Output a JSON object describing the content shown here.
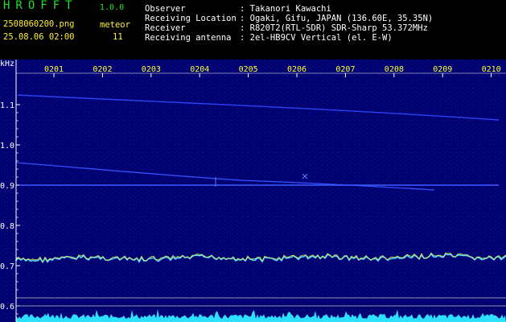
{
  "header": {
    "app_name": "HROFFT",
    "app_version": "1.0.0",
    "file_name": "2508060200.png",
    "datetime": "25.08.06 02:00",
    "meteor_label": "meteor",
    "meteor_count": "11",
    "info_rows": [
      {
        "key": "Observer",
        "value": ": Takanori Kawachi"
      },
      {
        "key": "Receiving Location",
        "value": ": Ogaki, Gifu, JAPAN (136.60E, 35.35N)"
      },
      {
        "key": "Receiver",
        "value": ": R820T2(RTL-SDR) SDR-Sharp 53.372MHz"
      },
      {
        "key": "Receiving antenna",
        "value": ": 2el-HB9CV Vertical (el. E-W)"
      }
    ]
  },
  "spectrogram": {
    "y_unit": "kHz",
    "y_ticks": [
      "1.1",
      "1.0",
      "0.9",
      "0.8",
      "0.7",
      "0.6"
    ],
    "x_ticks": [
      "0201",
      "0202",
      "0203",
      "0204",
      "0205",
      "0206",
      "0207",
      "0208",
      "0209",
      "0210"
    ],
    "colors": {
      "background": "#00006e",
      "signal": "#2d4cff",
      "noise_band": "#55d8ff",
      "axis": "#ffffff",
      "tick_label": "#ffff33"
    }
  }
}
